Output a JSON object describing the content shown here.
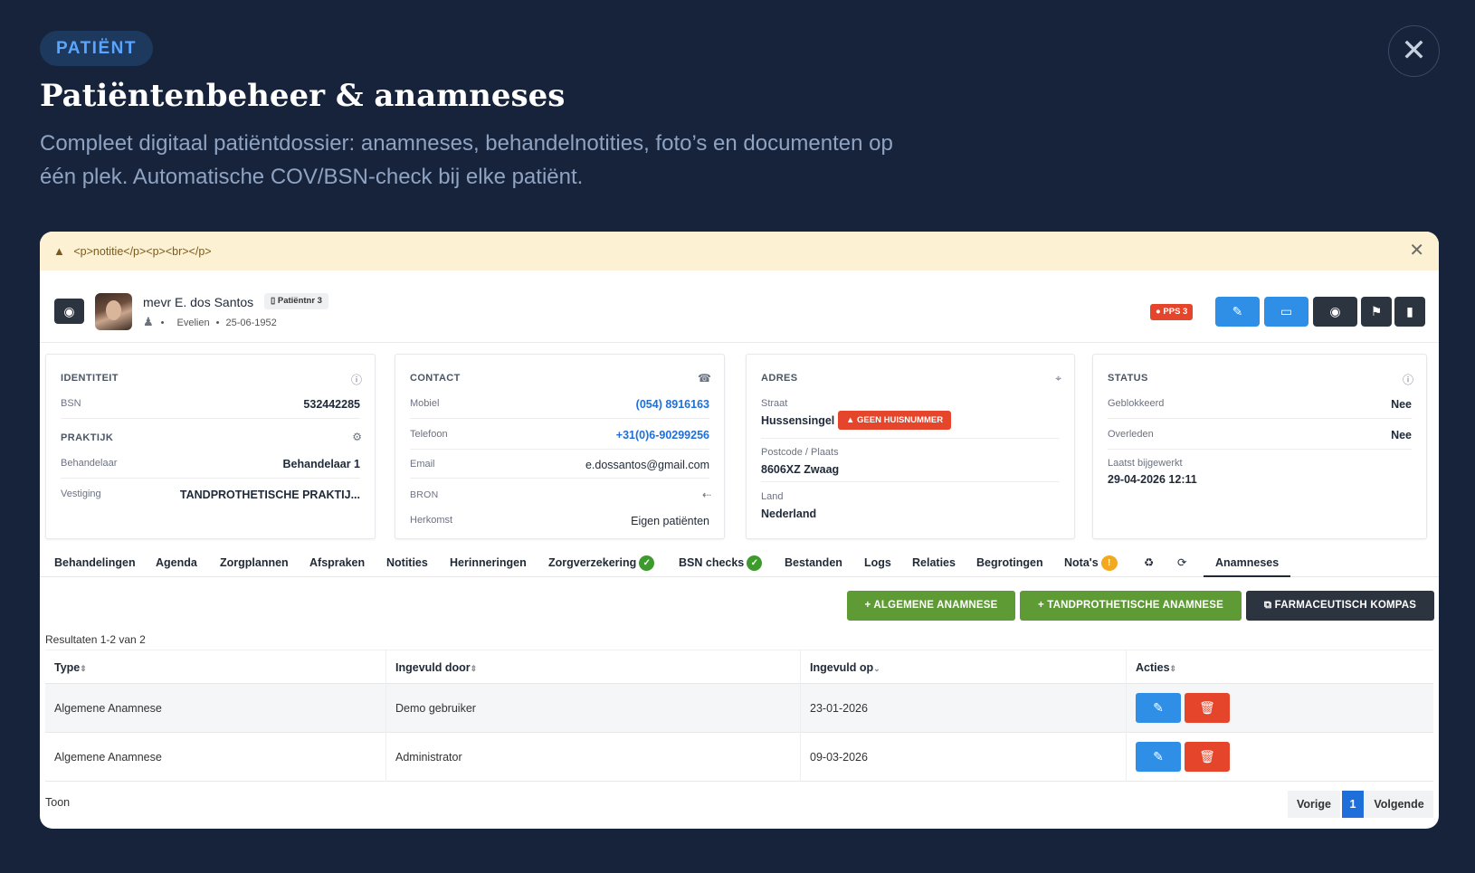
{
  "hero": {
    "badge": "PATIËNT",
    "title": "Patiëntenbeheer & anamneses",
    "subtitle_line1": "Compleet digitaal patiëntdossier: anamneses, behandelnotities, foto’s en documenten op",
    "subtitle_line2": "één plek. Automatische COV/BSN-check bij elke patiënt.",
    "close_symbol": "✕"
  },
  "alert": {
    "text": "<p>notitie</p><p><br></p>",
    "close_symbol": "✕",
    "icon": "warning-icon"
  },
  "patient": {
    "name": "mevr E. dos Santos",
    "patient_nr": "Patiëntnr 3",
    "first_name": "Evelien",
    "birthdate": "25-06-1952",
    "pps_badge": "PPS 3"
  },
  "cards": {
    "identiteit": {
      "title": "IDENTITEIT",
      "bsn_label": "BSN",
      "bsn_value": "532442285"
    },
    "praktijk": {
      "title": "PRAKTIJK",
      "behandelaar_label": "Behandelaar",
      "behandelaar_value": "Behandelaar 1",
      "vestiging_label": "Vestiging",
      "vestiging_value": "TANDPROTHETISCHE PRAKTIJ..."
    },
    "contact": {
      "title": "CONTACT",
      "mobiel_label": "Mobiel",
      "mobiel_value": "(054) 8916163",
      "telefoon_label": "Telefoon",
      "telefoon_value": "+31(0)6-90299256",
      "email_label": "Email",
      "email_value": "e.dossantos@gmail.com",
      "bron_label": "BRON",
      "herkomst_label": "Herkomst",
      "herkomst_value": "Eigen patiënten"
    },
    "adres": {
      "title": "ADRES",
      "straat_label": "Straat",
      "straat_value": "Hussensingel",
      "geen_huisnummer": "GEEN HUISNUMMER",
      "postcode_label": "Postcode / Plaats",
      "postcode_value": "8606XZ Zwaag",
      "land_label": "Land",
      "land_value": "Nederland"
    },
    "status": {
      "title": "STATUS",
      "geblokkeerd_label": "Geblokkeerd",
      "geblokkeerd_value": "Nee",
      "overleden_label": "Overleden",
      "overleden_value": "Nee",
      "bijgewerkt_label": "Laatst bijgewerkt",
      "bijgewerkt_value": "29-04-2026 12:11"
    }
  },
  "tabs": [
    "Behandelingen",
    "Agenda",
    "Zorgplannen",
    "Afspraken",
    "Notities",
    "Herinneringen",
    "Zorgverzekering",
    "BSN checks",
    "Bestanden",
    "Logs",
    "Relaties",
    "Begrotingen",
    "Nota's",
    "Anamneses"
  ],
  "actions": {
    "algemene": "+ ALGEMENE ANAMNESE",
    "tandprothetische": "+ TANDPROTHETISCHE ANAMNESE",
    "farmaceutisch": "FARMACEUTISCH KOMPAS"
  },
  "table": {
    "results": "Resultaten 1-2 van 2",
    "headers": [
      "Type",
      "Ingevuld door",
      "Ingevuld op",
      "Acties"
    ],
    "rows": [
      [
        "Algemene Anamnese",
        "Demo gebruiker",
        "23-01-2026"
      ],
      [
        "Algemene Anamnese",
        "Administrator",
        "09-03-2026"
      ]
    ]
  },
  "footer": {
    "toon": "Toon",
    "vorige": "Vorige",
    "page": "1",
    "volgende": "Volgende"
  },
  "colors": {
    "background": "#17233a",
    "blue": "#2f8ee6",
    "red": "#e5452b",
    "green": "#5e9b34",
    "dark": "#2c3440"
  }
}
